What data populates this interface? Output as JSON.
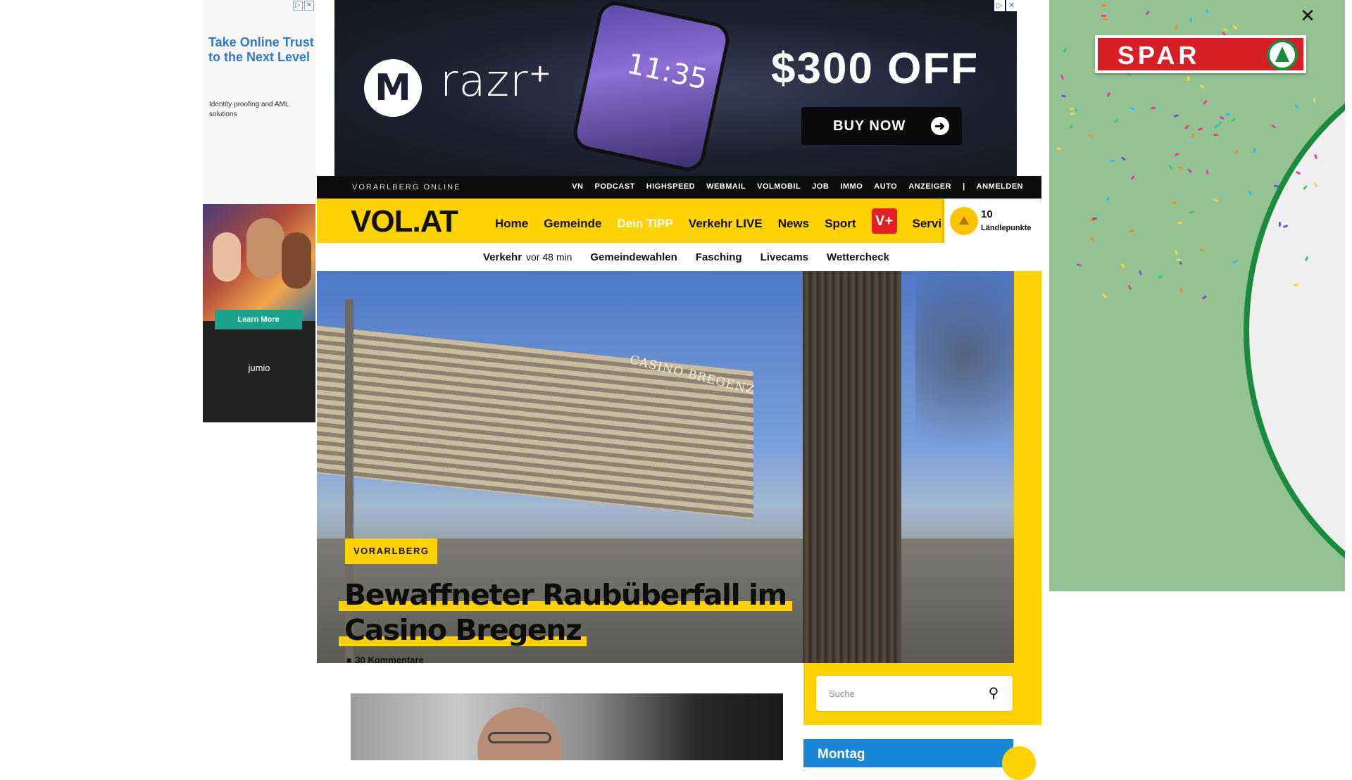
{
  "ads": {
    "left": {
      "headline": "Take Online Trust to the Next Level",
      "sub": "Identity proofing and AML solutions",
      "cta": "Learn More",
      "brand": "jumio"
    },
    "top": {
      "logo_glyph": "M",
      "product": "razr⁺",
      "phone_time": "11:35",
      "offer": "$300 OFF",
      "cta": "BUY NOW"
    },
    "right": {
      "brand": "SPAR",
      "close_glyph": "✕",
      "colors": {
        "bg": "#93c393",
        "brand_red": "#d61f26",
        "brand_green": "#1c8a3c"
      }
    },
    "ad_choice_glyphs": [
      "▷",
      "✕"
    ]
  },
  "site": {
    "strip_brand": "VORARLBERG ONLINE",
    "top_links": [
      "VN",
      "PODCAST",
      "HIGHSPEED",
      "WEBMAIL",
      "VOLMOBIL",
      "JOB",
      "IMMO",
      "AUTO",
      "ANZEIGER",
      "|",
      "ANMELDEN"
    ],
    "logo": "VOL.AT",
    "nav": [
      "Home",
      "Gemeinde",
      "Dein TIPP",
      "Verkehr LIVE",
      "News",
      "Sport"
    ],
    "vplus": "V+",
    "service": "Service",
    "points": {
      "value": "10",
      "label": "Ländlepunkte"
    },
    "subnav": {
      "verkehr": "Verkehr",
      "verkehr_ago": "vor 48 min",
      "items": [
        "Gemeindewahlen",
        "Fasching",
        "Livecams",
        "Wettercheck"
      ]
    },
    "colors": {
      "accent": "#ffd200",
      "strip": "#0d0d0d",
      "vplus": "#e31e24"
    }
  },
  "article": {
    "category": "VORARLBERG",
    "headline_line1": "Bewaffneter Raubüberfall im",
    "headline_line2": "Casino Bregenz",
    "comments": "30 Kommentare",
    "hero_sign": "CASINO BREGENZ"
  },
  "sidebar": {
    "search_placeholder": "Suche",
    "weather_day": "Montag"
  }
}
